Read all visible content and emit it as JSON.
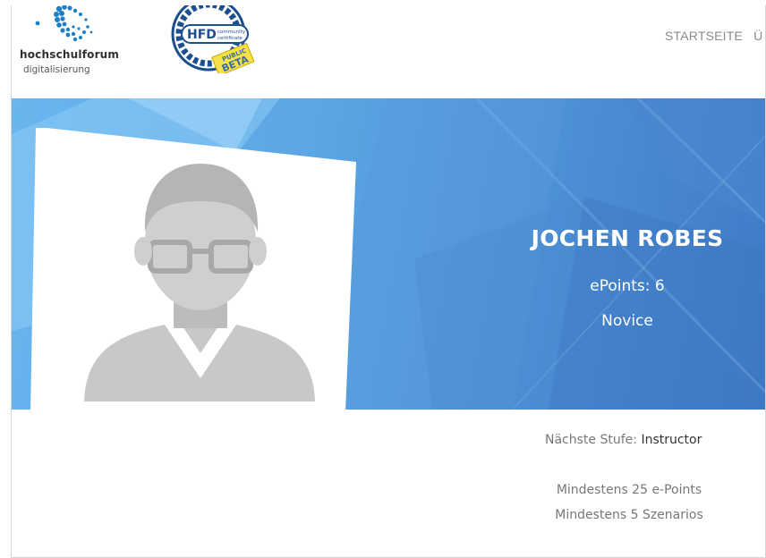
{
  "header": {
    "logo": {
      "word": "hochschulforum",
      "sub": "digitalisierung"
    },
    "badge": {
      "main": "HFD",
      "sub1": "community",
      "sub2": "certificate",
      "ribbon1": "PUBLIC",
      "ribbon2": "BETA"
    },
    "nav": [
      {
        "label": "STARTSEITE"
      },
      {
        "label": "Ü"
      }
    ]
  },
  "colors": {
    "hero_start": "#69b6ef",
    "hero_end": "#3f79c6",
    "text_light": "#ffffff",
    "text_muted": "#777777",
    "text_dark": "#333333"
  },
  "profile": {
    "name": "JOCHEN ROBES",
    "epoints": "ePoints: 6",
    "rank": "Novice",
    "avatar_icon": "user-avatar-placeholder-icon"
  },
  "next_level": {
    "label": "Nächste Stufe:",
    "value": "Instructor",
    "requirements": [
      "Mindestens 25 e-Points",
      "Mindestens 5 Szenarios"
    ]
  }
}
